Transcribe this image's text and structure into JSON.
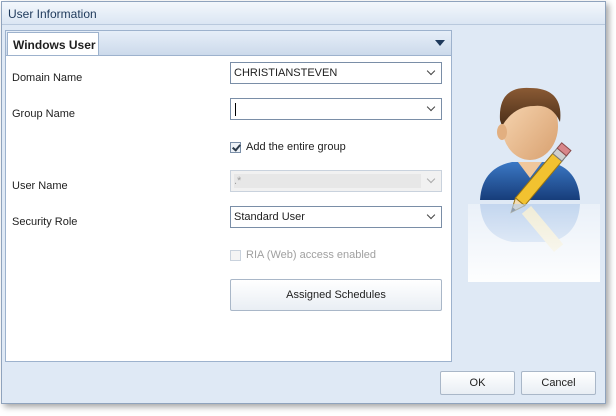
{
  "window": {
    "title": "User Information"
  },
  "tab": {
    "label": "Windows User"
  },
  "form": {
    "domain_name": {
      "label": "Domain Name",
      "value": "CHRISTIANSTEVEN"
    },
    "group_name": {
      "label": "Group Name",
      "value": ""
    },
    "add_entire_group": {
      "label": "Add the entire group",
      "checked": true
    },
    "user_name": {
      "label": "User Name",
      "value": ".*"
    },
    "security_role": {
      "label": "Security Role",
      "value": "Standard User"
    },
    "ria_access": {
      "label": "RIA (Web) access enabled",
      "checked": false
    },
    "assigned_schedules_label": "Assigned Schedules"
  },
  "footer": {
    "ok_label": "OK",
    "cancel_label": "Cancel"
  },
  "icons": {
    "avatar": "user-edit-icon"
  }
}
